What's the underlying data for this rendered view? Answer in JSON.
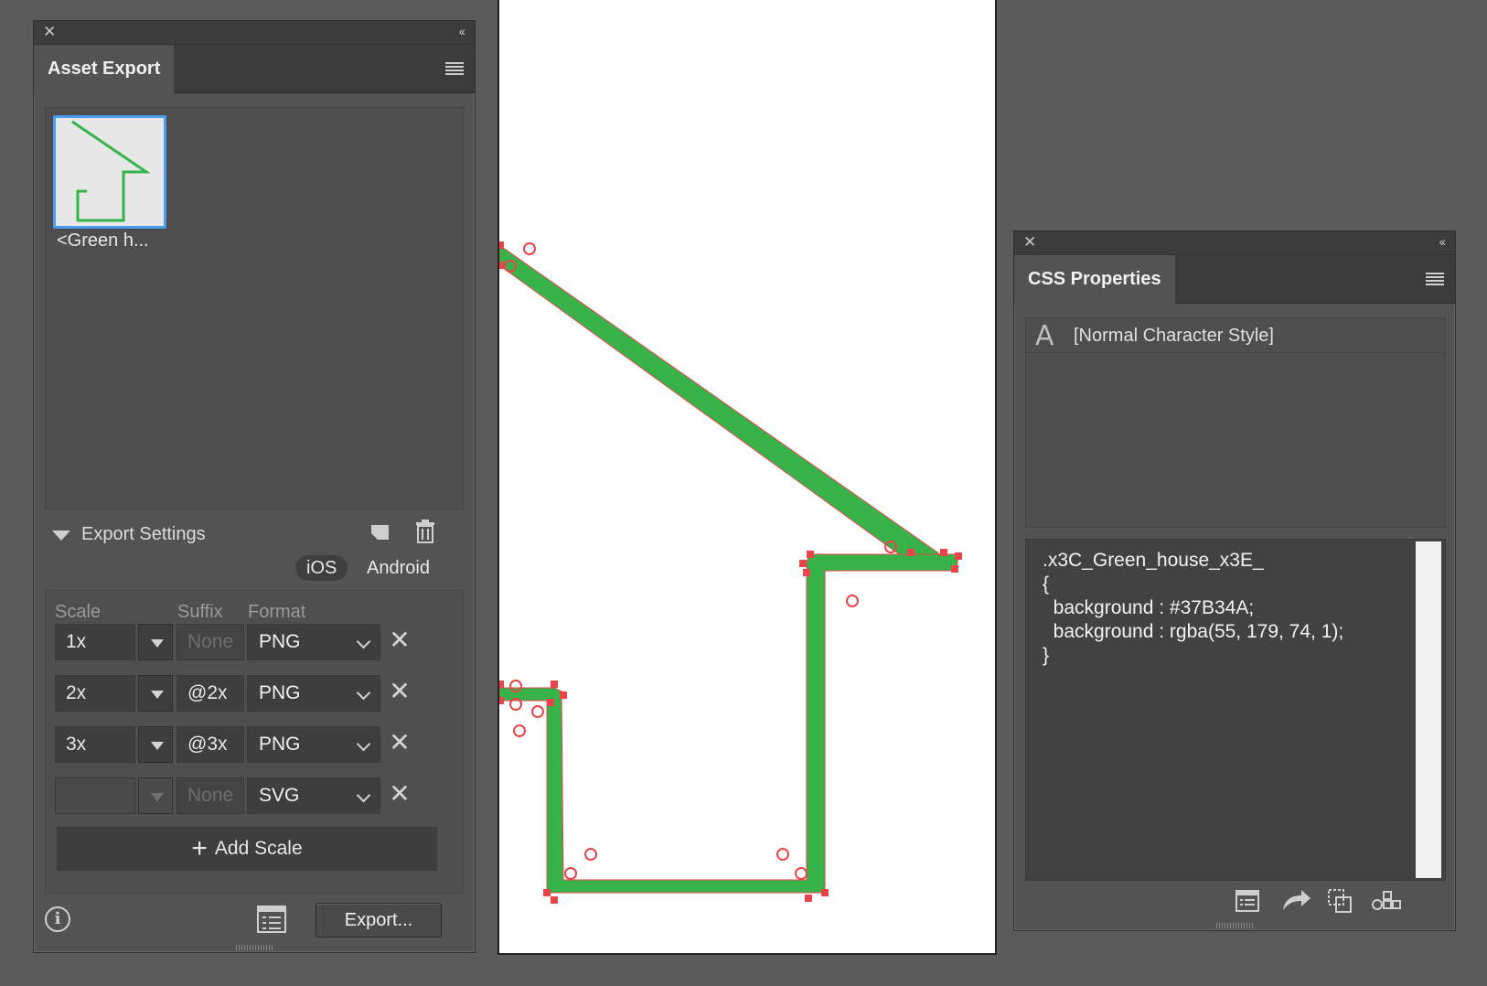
{
  "asset_panel": {
    "tab_title": "Asset Export",
    "asset_label": "<Green h...",
    "export_settings_title": "Export Settings",
    "platforms": [
      "iOS",
      "Android"
    ],
    "columns": {
      "scale": "Scale",
      "suffix": "Suffix",
      "format": "Format"
    },
    "rows": [
      {
        "scale": "1x",
        "suffix": "None",
        "suffix_placeholder": true,
        "format": "PNG",
        "disabled": false
      },
      {
        "scale": "2x",
        "suffix": "@2x",
        "suffix_placeholder": false,
        "format": "PNG",
        "disabled": false
      },
      {
        "scale": "3x",
        "suffix": "@3x",
        "suffix_placeholder": false,
        "format": "PNG",
        "disabled": false
      },
      {
        "scale": "",
        "suffix": "None",
        "suffix_placeholder": true,
        "format": "SVG",
        "disabled": true
      }
    ],
    "add_scale_label": "Add Scale",
    "export_button": "Export...",
    "info_glyph": "i"
  },
  "css_panel": {
    "tab_title": "CSS Properties",
    "style_glyph": "A",
    "character_style": "[Normal Character Style]",
    "code_lines": [
      ".x3C_Green_house_x3E_",
      "{",
      "  background : #37B34A;",
      "  background : rgba(55, 179, 74, 1);",
      "}"
    ]
  },
  "colors": {
    "shape_fill": "#37B34A",
    "selection": "#e8454a",
    "thumb_border": "#4a9cf0"
  },
  "icons": {
    "close": "close-icon",
    "collapse": "collapse-icon",
    "menu": "panel-menu-icon",
    "new_item": "new-item-icon",
    "trash": "trash-icon"
  }
}
